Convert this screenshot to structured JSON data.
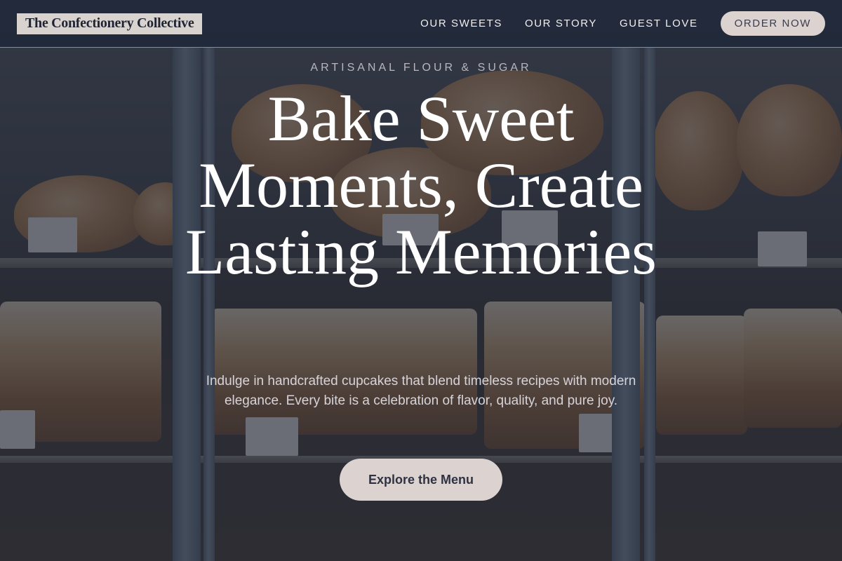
{
  "header": {
    "brand": "The Confectionery Collective",
    "nav": [
      {
        "label": "OUR SWEETS"
      },
      {
        "label": "OUR STORY"
      },
      {
        "label": "GUEST LOVE"
      }
    ],
    "order_label": "ORDER NOW"
  },
  "hero": {
    "eyebrow": "ARTISANAL FLOUR & SUGAR",
    "headline": "Bake Sweet Moments, Create Lasting Memories",
    "subtext": "Indulge in handcrafted cupcakes that blend timeless recipes with modern elegance. Every bite is a celebration of flavor, quality, and pure joy.",
    "cta_label": "Explore the Menu"
  },
  "colors": {
    "header_bg": "#1e2638",
    "button_bg": "#dcd2d0",
    "headline": "#ffffff"
  }
}
